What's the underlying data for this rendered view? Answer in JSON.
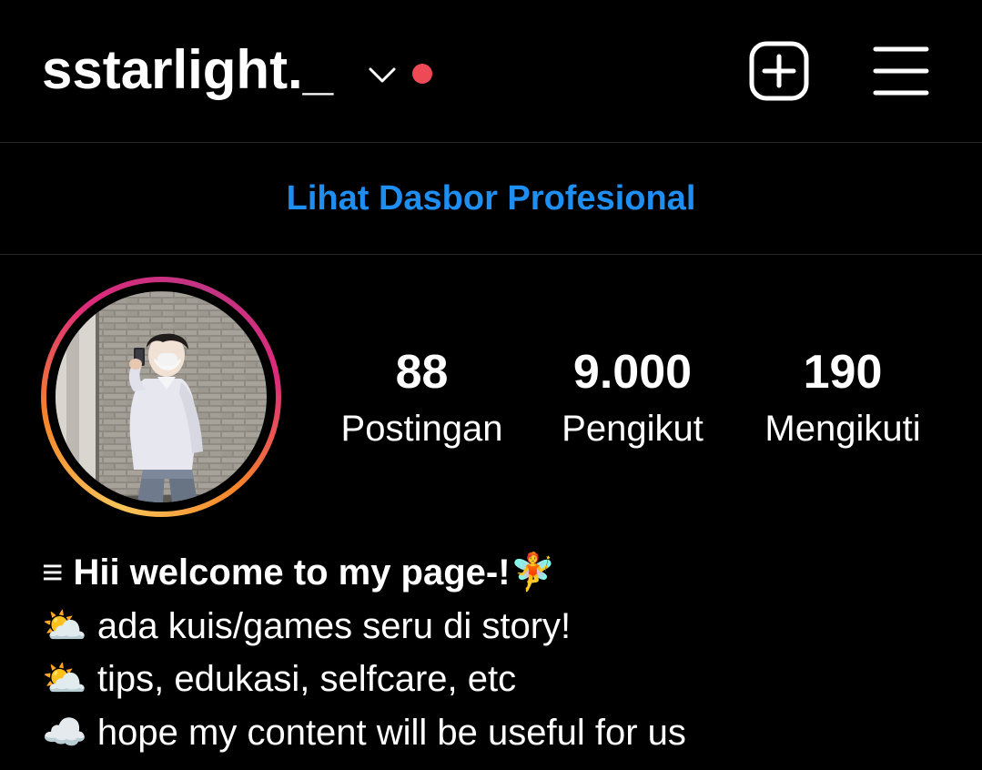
{
  "header": {
    "username": "sstarlight._",
    "chevron_icon": "chevron-down-icon",
    "notification_dot_color": "#ed4956",
    "add_icon": "plus-square-icon",
    "menu_icon": "hamburger-menu-icon"
  },
  "dashboard": {
    "label": "Lihat Dasbor Profesional",
    "color": "#1f8ef1"
  },
  "profile": {
    "avatar_icon": "profile-photo",
    "story_ring": true
  },
  "stats": [
    {
      "value": "88",
      "label": "Postingan"
    },
    {
      "value": "9.000",
      "label": "Pengikut"
    },
    {
      "value": "190",
      "label": "Mengikuti"
    }
  ],
  "bio": {
    "lines": [
      "≡ Hii welcome to my page-!🧚",
      "⛅ ada kuis/games seru di story!",
      "⛅ tips, edukasi, selfcare, etc",
      "☁️ hope my content will be useful for us"
    ]
  }
}
